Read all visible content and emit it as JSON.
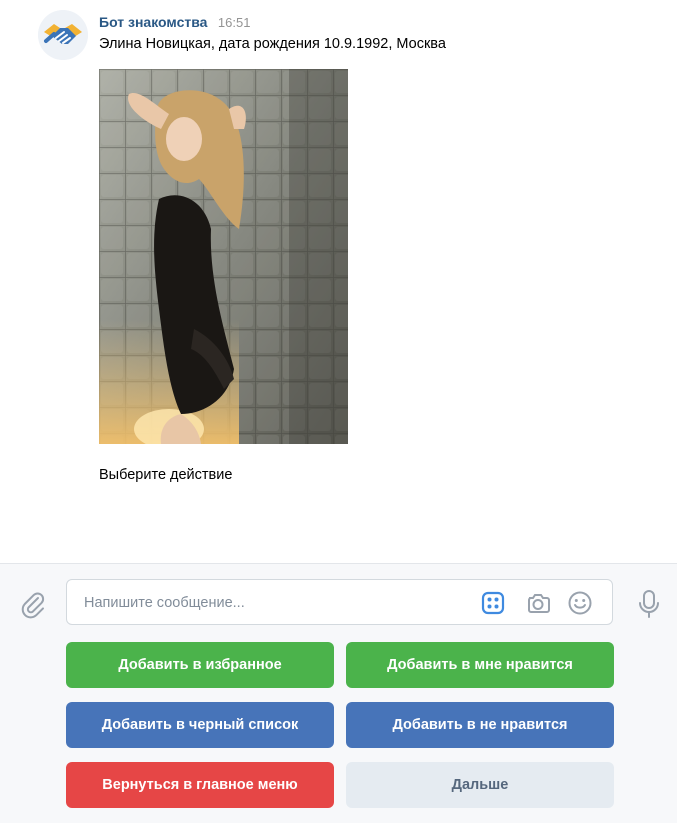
{
  "message": {
    "sender": "Бот знакомства",
    "time": "16:51",
    "profile_text": "Элина Новицкая, дата рождения 10.9.1992, Москва",
    "prompt_text": "Выберите действие"
  },
  "composer": {
    "placeholder": "Напишите сообщение..."
  },
  "keyboard": {
    "add_favorite": "Добавить в избранное",
    "add_like": "Добавить в мне нравится",
    "add_blacklist": "Добавить в черный список",
    "add_dislike": "Добавить в не нравится",
    "back_to_menu": "Вернуться в главное меню",
    "next": "Дальше"
  },
  "colors": {
    "green": "#4bb34b",
    "blue": "#4774b9",
    "red": "#e64646",
    "grey": "#e5ebf1",
    "link": "#2a5885",
    "icon": "#99a2ad",
    "accent": "#3f8ae0"
  },
  "icons": [
    "handshake-avatar",
    "paperclip-icon",
    "keyboard-icon",
    "camera-icon",
    "smile-icon",
    "microphone-icon"
  ]
}
